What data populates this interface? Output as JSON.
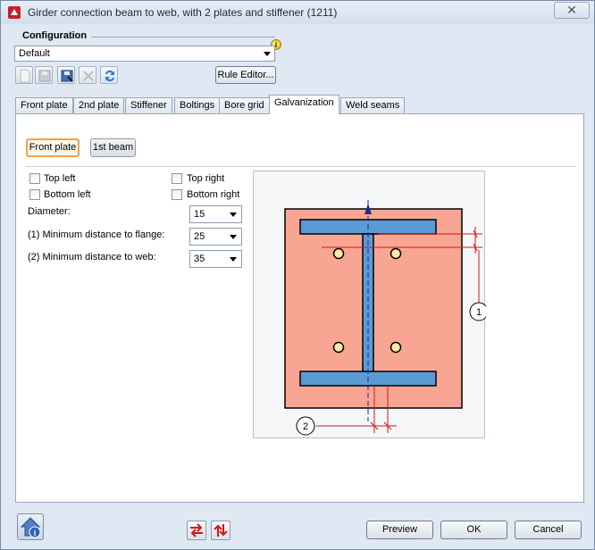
{
  "window": {
    "title": "Girder connection beam to web, with 2 plates and stiffener (1211)",
    "close": "✕"
  },
  "configuration": {
    "legend": "Configuration",
    "selected": "Default",
    "rule_editor": "Rule Editor..."
  },
  "tabs": [
    {
      "label": "Front plate"
    },
    {
      "label": "2nd plate"
    },
    {
      "label": "Stiffener"
    },
    {
      "label": "Boltings"
    },
    {
      "label": "Bore grid"
    },
    {
      "label": "Galvanization"
    },
    {
      "label": "Weld seams"
    }
  ],
  "active_tab": "Galvanization",
  "subtabs": [
    {
      "label": "Front plate"
    },
    {
      "label": "1st beam"
    }
  ],
  "checkboxes": {
    "top_left": "Top left",
    "top_right": "Top right",
    "bottom_left": "Bottom left",
    "bottom_right": "Bottom right"
  },
  "fields": {
    "diameter": {
      "label": "Diameter:",
      "value": "15"
    },
    "min_flange": {
      "label": "(1) Minimum distance to flange:",
      "value": "25"
    },
    "min_web": {
      "label": "(2) Minimum distance to web:",
      "value": "35"
    }
  },
  "drawing": {
    "marker_1": "1",
    "marker_2": "2",
    "plate_color": "#f8a693",
    "beam_color": "#5b9bd5"
  },
  "footer": {
    "preview": "Preview",
    "ok": "OK",
    "cancel": "Cancel"
  }
}
